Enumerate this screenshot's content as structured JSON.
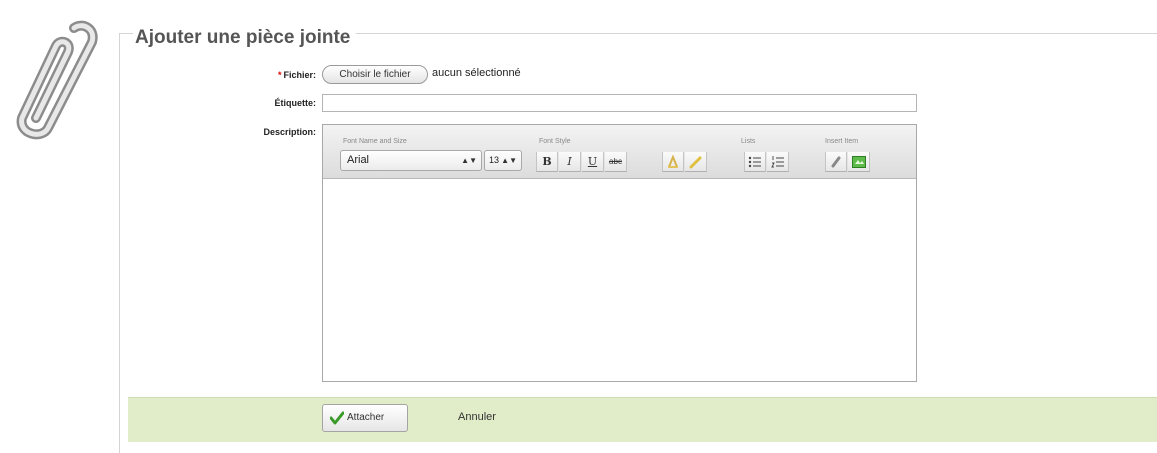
{
  "form": {
    "legend": "Ajouter une pièce jointe",
    "file_label": "Fichier:",
    "required_mark": "*",
    "file_button": "Choisir le fichier",
    "file_status": "aucun sélectionné",
    "label_label": "Étiquette:",
    "label_value": "",
    "description_label": "Description:"
  },
  "editor": {
    "groups": {
      "font": "Font Name and Size",
      "style": "Font Style",
      "lists": "Lists",
      "insert": "Insert Item"
    },
    "font_name": "Arial",
    "font_size": "13",
    "bold": "B",
    "italic": "I",
    "underline": "U",
    "strike": "abc",
    "content": ""
  },
  "footer": {
    "attach_label": "Attacher",
    "cancel_label": "Annuler"
  },
  "colors": {
    "footer_bg": "#e1ecc8",
    "required": "#dd0000",
    "check": "#3a9a2a"
  },
  "icons": {
    "attachment": "paperclip-icon",
    "attach_button": "checkmark-icon",
    "text_color": "text-color-icon",
    "highlight": "highlight-pen-icon",
    "bullet_list": "bullet-list-icon",
    "numbered_list": "numbered-list-icon",
    "link": "link-icon",
    "image": "image-icon"
  }
}
